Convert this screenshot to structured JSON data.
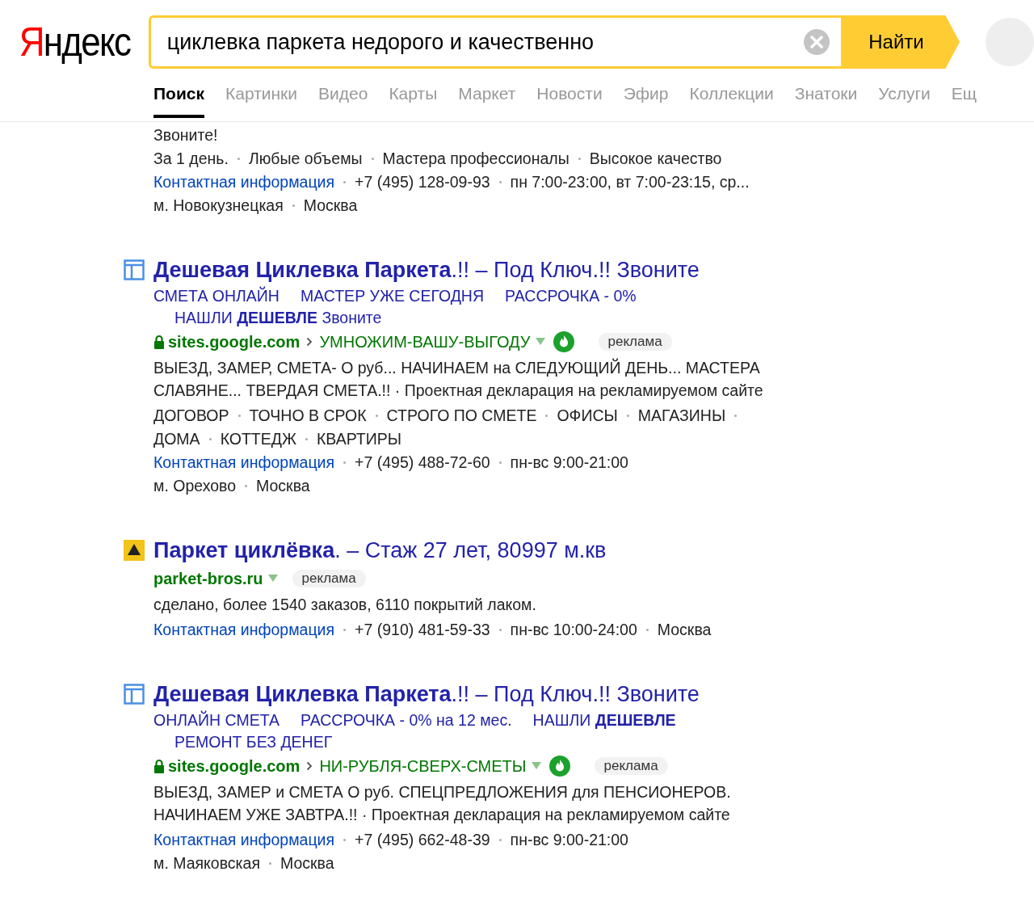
{
  "header": {
    "logo": "Яндекс",
    "search": {
      "value": "циклевка паркета недорого и качественно"
    },
    "submit": "Найти"
  },
  "tabs": [
    {
      "label": "Поиск",
      "selected": true
    },
    {
      "label": "Картинки",
      "selected": false
    },
    {
      "label": "Видео",
      "selected": false
    },
    {
      "label": "Карты",
      "selected": false
    },
    {
      "label": "Маркет",
      "selected": false
    },
    {
      "label": "Новости",
      "selected": false
    },
    {
      "label": "Эфир",
      "selected": false
    },
    {
      "label": "Коллекции",
      "selected": false
    },
    {
      "label": "Знатоки",
      "selected": false
    },
    {
      "label": "Услуги",
      "selected": false
    },
    {
      "label": "Ещ",
      "selected": false
    }
  ],
  "partial_result": {
    "text": "Звоните!",
    "features": [
      "За 1 день.",
      "Любые объемы",
      "Мастера профессионалы",
      "Высокое качество"
    ],
    "contacts": [
      {
        "kind": "link",
        "text": "Контактная информация"
      },
      {
        "kind": "text",
        "text": "+7 (495) 128-09-93"
      },
      {
        "kind": "text",
        "text": "пн 7:00-23:00, вт 7:00-23:15, ср..."
      }
    ],
    "location": [
      "м. Новокузнецкая",
      "Москва"
    ]
  },
  "results": [
    {
      "kind": "sitelinks",
      "title": "**Дешевая Циклевка Паркета**.!! – Под Ключ.!! Звоните",
      "sitelink_rows": [
        [
          "СМЕТА ОНЛАЙН",
          "МАСТЕР УЖЕ СЕГОДНЯ",
          "РАССРОЧКА - 0%"
        ],
        [
          "НАШЛИ **ДЕШЕВЛЕ** Звоните"
        ]
      ],
      "secure": true,
      "domain": "sites.google.com",
      "path": "УМНОЖИМ-ВАШУ-ВЫГОДУ",
      "verified": true,
      "ad_label": "реклама",
      "description": "ВЫЕЗД, ЗАМЕР, СМЕТА- О руб... НАЧИНАЕМ на СЛЕДУЮЩИЙ ДЕНЬ... МАСТЕРА СЛАВЯНЕ... ТВЕРДАЯ СМЕТА.!! · Проектная декларация на рекламируемом сайте",
      "features": [
        "ДОГОВОР",
        "ТОЧНО В СРОК",
        "СТРОГО ПО СМЕТЕ",
        "ОФИСЫ",
        "МАГАЗИНЫ",
        "ДОМА",
        "КОТТЕДЖ",
        "КВАРТИРЫ"
      ],
      "contacts": [
        {
          "kind": "link",
          "text": "Контактная информация"
        },
        {
          "kind": "text",
          "text": "+7 (495) 488-72-60"
        },
        {
          "kind": "text",
          "text": "пн-вс 9:00-21:00"
        }
      ],
      "location": [
        "м. Орехово",
        "Москва"
      ]
    },
    {
      "kind": "brand",
      "title": "**Паркет циклёвка**. – Стаж 27 лет, 80997 м.кв",
      "secure": false,
      "domain": "parket-bros.ru",
      "verified": false,
      "ad_label": "реклама",
      "description": "сделано, более 1540 заказов, 6110 покрытий лаком.",
      "contacts": [
        {
          "kind": "link",
          "text": "Контактная информация"
        },
        {
          "kind": "text",
          "text": "+7 (910) 481-59-33"
        },
        {
          "kind": "text",
          "text": "пн-вс 10:00-24:00"
        },
        {
          "kind": "text",
          "text": "Москва"
        }
      ]
    },
    {
      "kind": "sitelinks",
      "title": "**Дешевая Циклевка Паркета**.!! – Под Ключ.!! Звоните",
      "sitelink_rows": [
        [
          "ОНЛАЙН СМЕТА",
          "РАССРОЧКА - 0% на 12 мес.",
          "НАШЛИ **ДЕШЕВЛЕ**"
        ],
        [
          "РЕМОНТ БЕЗ ДЕНЕГ"
        ]
      ],
      "secure": true,
      "domain": "sites.google.com",
      "path": "НИ-РУБЛЯ-СВЕРХ-СМЕТЫ",
      "verified": true,
      "ad_label": "реклама",
      "description": "ВЫЕЗД, ЗАМЕР и СМЕТА О руб. СПЕЦПРЕДЛОЖЕНИЯ для ПЕНСИОНЕРОВ. НАЧИНАЕМ УЖЕ ЗАВТРА.!! · Проектная декларация на рекламируемом сайте",
      "contacts": [
        {
          "kind": "link",
          "text": "Контактная информация"
        },
        {
          "kind": "text",
          "text": "+7 (495) 662-48-39"
        },
        {
          "kind": "text",
          "text": "пн-вс 9:00-21:00"
        }
      ],
      "location": [
        "м. Маяковская",
        "Москва"
      ]
    }
  ]
}
